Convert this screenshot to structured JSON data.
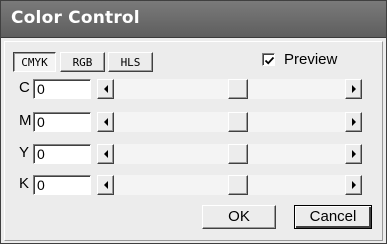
{
  "window": {
    "title": "Color Control"
  },
  "tabs": [
    {
      "label": "CMYK",
      "selected": true
    },
    {
      "label": "RGB",
      "selected": false
    },
    {
      "label": "HLS",
      "selected": false
    }
  ],
  "preview": {
    "label": "Preview",
    "checked": true
  },
  "channels": [
    {
      "label": "C",
      "value": "0"
    },
    {
      "label": "M",
      "value": "0"
    },
    {
      "label": "Y",
      "value": "0"
    },
    {
      "label": "K",
      "value": "0"
    }
  ],
  "buttons": {
    "ok": "OK",
    "cancel": "Cancel"
  },
  "icons": {
    "left_arrow": "left-arrow-icon",
    "right_arrow": "right-arrow-icon",
    "check": "checkmark-icon"
  }
}
